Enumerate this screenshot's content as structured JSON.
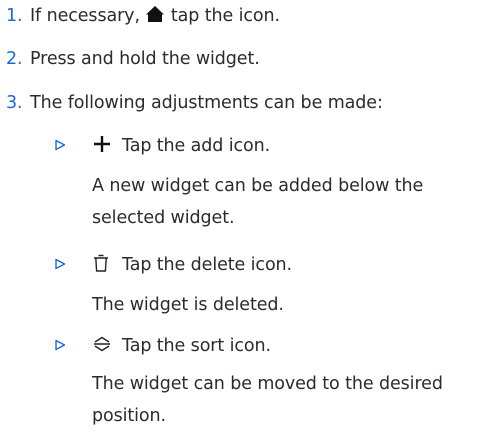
{
  "steps": [
    {
      "number": "1.",
      "text_before": "If necessary,",
      "icon": "home-icon",
      "text_after": "tap the icon."
    },
    {
      "number": "2.",
      "text": "Press and hold the widget."
    },
    {
      "number": "3.",
      "text": "The following adjustments can be made:"
    }
  ],
  "adjustments": [
    {
      "icon": "add-icon",
      "text": "Tap the add icon.",
      "result": "A new widget can be added below the selected widget."
    },
    {
      "icon": "delete-icon",
      "text": "Tap the delete icon.",
      "result": "The widget is deleted."
    },
    {
      "icon": "sort-icon",
      "text": "Tap the sort icon.",
      "result": "The widget can be moved to the desired position."
    }
  ],
  "colors": {
    "step_number": "#1c69d4",
    "bullet": "#1c69d4",
    "text": "#2b2b2b"
  }
}
